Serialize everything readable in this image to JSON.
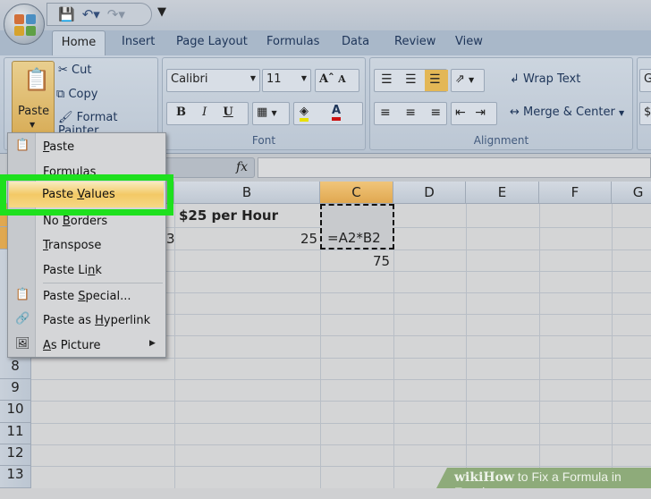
{
  "quick_access": {
    "icons": [
      "save-icon",
      "undo-icon",
      "redo-icon",
      "customize-icon"
    ]
  },
  "tabs": [
    "Home",
    "Insert",
    "Page Layout",
    "Formulas",
    "Data",
    "Review",
    "View"
  ],
  "clipboard": {
    "paste": "Paste",
    "cut": "Cut",
    "copy": "Copy",
    "format_painter": "Format Painter"
  },
  "font": {
    "name": "Calibri",
    "size": "11",
    "label": "Font",
    "bold": "B",
    "italic": "I",
    "underline": "U",
    "grow": "A",
    "shrink": "A",
    "fill_color": "#e8e000",
    "font_color": "#cc1111"
  },
  "alignment": {
    "wrap_text": "Wrap Text",
    "merge_center": "Merge & Center",
    "label": "Alignment"
  },
  "number": {
    "format_partial": "G",
    "partial2": "$"
  },
  "formula_bar": {
    "fx": "fx"
  },
  "paste_menu": [
    {
      "label": "Paste",
      "u": "P",
      "rest": "aste"
    },
    {
      "label": "Formulas"
    },
    {
      "label": "Paste Values",
      "pre": "Paste ",
      "u": "V",
      "rest": "alues"
    },
    {
      "label": "No Borders",
      "pre": "No ",
      "u": "B",
      "rest": "orders"
    },
    {
      "label": "Transpose",
      "u": "T",
      "rest": "ranspose"
    },
    {
      "label": "Paste Link",
      "pre": "Paste Li",
      "u": "n",
      "rest": "k"
    },
    {
      "label": "Paste Special...",
      "pre": "Paste ",
      "u": "S",
      "rest": "pecial..."
    },
    {
      "label": "Paste as Hyperlink",
      "pre": "Paste as ",
      "u": "H",
      "rest": "yperlink"
    },
    {
      "label": "As Picture",
      "u": "A",
      "rest": "s Picture"
    }
  ],
  "sheet": {
    "columns": [
      "B",
      "C",
      "D",
      "E",
      "F",
      "G"
    ],
    "rows": [
      "8",
      "9",
      "10",
      "11",
      "12",
      "13"
    ],
    "cells": {
      "B1": "$25 per Hour",
      "A2_partial": "3",
      "B2": "25",
      "C2": "=A2*B2",
      "C3": "75"
    }
  },
  "watermark": {
    "wiki": "wiki",
    "how": "How",
    "title": "to Fix a Formula in Excel"
  }
}
